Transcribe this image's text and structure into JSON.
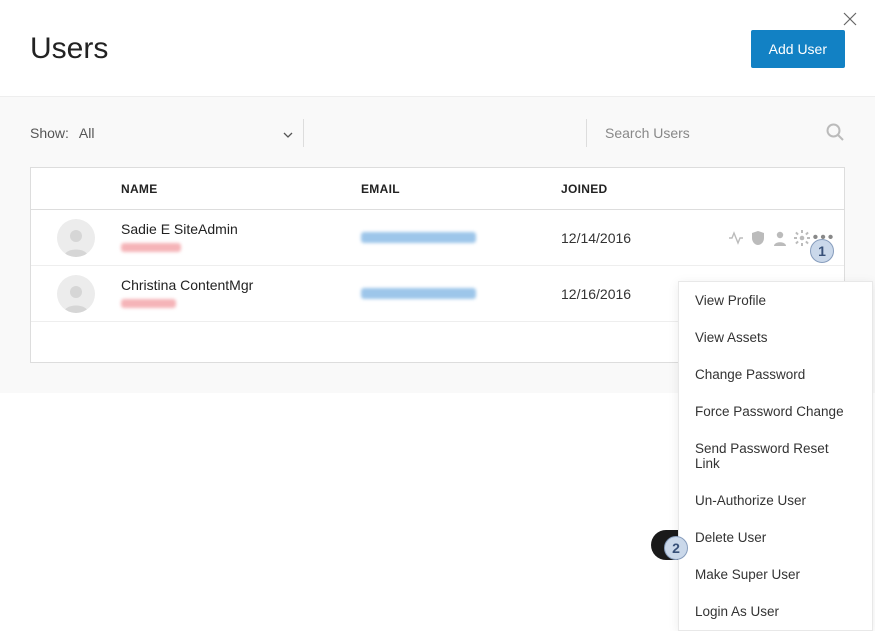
{
  "header": {
    "title": "Users",
    "add_user_label": "Add User"
  },
  "filter": {
    "show_label": "Show:",
    "show_value": "All",
    "search_placeholder": "Search Users"
  },
  "table": {
    "columns": {
      "name": "NAME",
      "email": "EMAIL",
      "joined": "JOINED"
    },
    "rows": [
      {
        "name": "Sadie E SiteAdmin",
        "joined": "12/14/2016"
      },
      {
        "name": "Christina ContentMgr",
        "joined": "12/16/2016"
      }
    ]
  },
  "menu": {
    "items": [
      "View Profile",
      "View Assets",
      "Change Password",
      "Force Password Change",
      "Send Password Reset Link",
      "Un-Authorize User",
      "Delete User",
      "Make Super User",
      "Login As User"
    ]
  },
  "callouts": {
    "one": "1",
    "two": "2"
  }
}
